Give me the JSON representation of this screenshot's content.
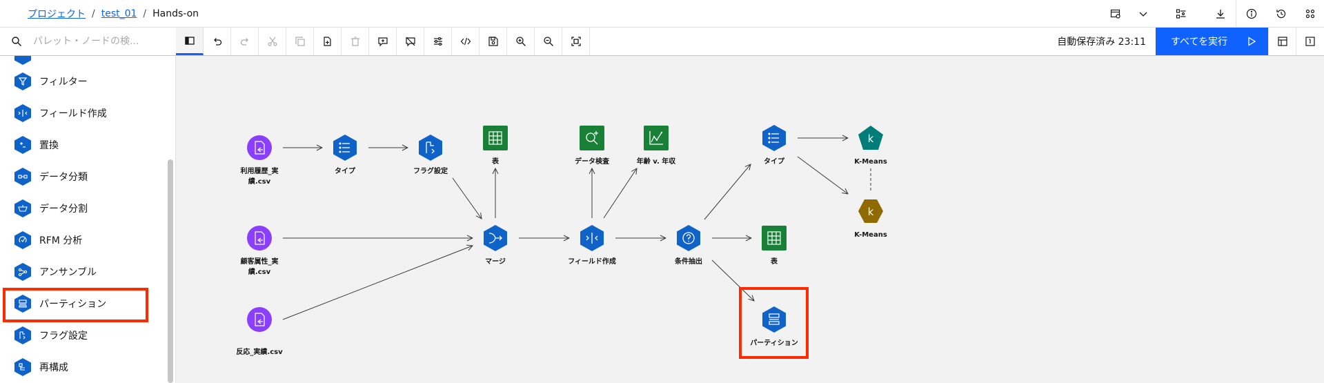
{
  "breadcrumb": {
    "project": "プロジェクト",
    "flow": "test_01",
    "current": "Hands-on"
  },
  "toolbar": {
    "search_placeholder": "パレット・ノードの検...",
    "autosave": "自動保存済み 23:11",
    "run_all": "すべてを実行"
  },
  "palette": {
    "items": [
      {
        "label": "フィルター",
        "icon": "filter-icon"
      },
      {
        "label": "フィールド作成",
        "icon": "derive-icon"
      },
      {
        "label": "置換",
        "icon": "replace-icon"
      },
      {
        "label": "データ分類",
        "icon": "binning-icon"
      },
      {
        "label": "データ分割",
        "icon": "split-icon"
      },
      {
        "label": "RFM 分析",
        "icon": "rfm-icon"
      },
      {
        "label": "アンサンブル",
        "icon": "ensemble-icon"
      },
      {
        "label": "パーティション",
        "icon": "partition-icon"
      },
      {
        "label": "フラグ設定",
        "icon": "set-to-flag-icon"
      },
      {
        "label": "再構成",
        "icon": "restructure-icon"
      }
    ]
  },
  "nodes": {
    "usage_csv": "利用履歴_実\n績.csv",
    "type1": "タイプ",
    "flag": "フラグ設定",
    "table1": "表",
    "customer_csv": "顧客属性_実\n績.csv",
    "merge": "マージ",
    "reaction_csv": "反応_実績.csv",
    "data_audit": "データ検査",
    "plot": "年齢 v. 年収",
    "derive": "フィールド作成",
    "select": "条件抽出",
    "type2": "タイプ",
    "table2": "表",
    "partition": "パーティション",
    "kmeans1": "K-Means",
    "kmeans2": "K-Means",
    "kmeans_glyph": "k"
  },
  "colors": {
    "accent": "#0f62fe",
    "node_blue": "#0f62c7",
    "node_purple": "#8a3ffc",
    "node_green": "#198038",
    "node_teal": "#007d79",
    "node_olive": "#8e6a00",
    "highlight": "#ff2a00"
  }
}
